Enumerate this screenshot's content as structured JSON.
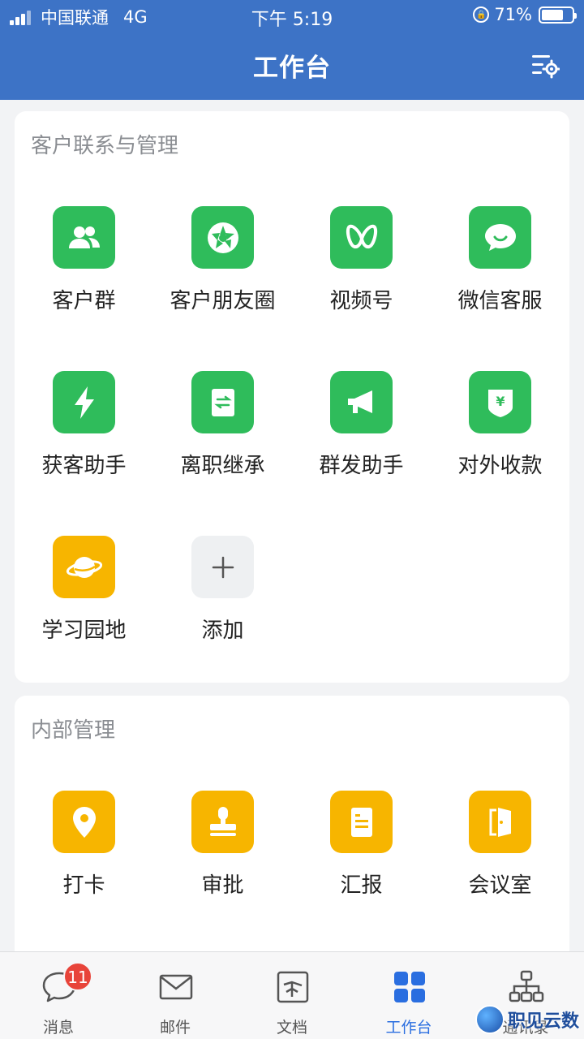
{
  "status_bar": {
    "carrier": "中国联通",
    "network": "4G",
    "time": "下午 5:19",
    "battery": "71%",
    "battery_level": 0.71
  },
  "header": {
    "title": "工作台",
    "settings_icon": "list-settings-icon",
    "background": "#3d73c6"
  },
  "sections": [
    {
      "title": "客户联系与管理",
      "items": [
        {
          "label": "客户群",
          "icon": "people-icon",
          "color": "#2fbc5b"
        },
        {
          "label": "客户朋友圈",
          "icon": "aperture-icon",
          "color": "#2fbc5b"
        },
        {
          "label": "视频号",
          "icon": "butterfly-icon",
          "color": "#2fbc5b"
        },
        {
          "label": "微信客服",
          "icon": "chat-bubble-icon",
          "color": "#2fbc5b"
        },
        {
          "label": "获客助手",
          "icon": "lightning-icon",
          "color": "#2fbc5b"
        },
        {
          "label": "离职继承",
          "icon": "transfer-doc-icon",
          "color": "#2fbc5b"
        },
        {
          "label": "群发助手",
          "icon": "megaphone-icon",
          "color": "#2fbc5b"
        },
        {
          "label": "对外收款",
          "icon": "yuan-shield-icon",
          "color": "#2fbc5b"
        },
        {
          "label": "学习园地",
          "icon": "planet-icon",
          "color": "#f7b500"
        },
        {
          "label": "添加",
          "icon": "plus-icon",
          "color": "#eef0f2"
        }
      ]
    },
    {
      "title": "内部管理",
      "items": [
        {
          "label": "打卡",
          "icon": "location-pin-icon",
          "color": "#f7b500"
        },
        {
          "label": "审批",
          "icon": "stamp-icon",
          "color": "#f7b500"
        },
        {
          "label": "汇报",
          "icon": "report-doc-icon",
          "color": "#f7b500"
        },
        {
          "label": "会议室",
          "icon": "door-icon",
          "color": "#f7b500"
        }
      ]
    }
  ],
  "tabbar": {
    "items": [
      {
        "label": "消息",
        "icon": "chat-icon",
        "badge": "11"
      },
      {
        "label": "邮件",
        "icon": "mail-icon"
      },
      {
        "label": "文档",
        "icon": "document-icon"
      },
      {
        "label": "工作台",
        "icon": "grid-icon",
        "active": true
      },
      {
        "label": "通讯录",
        "icon": "org-chart-icon"
      }
    ],
    "active_color": "#2a6ee0"
  },
  "watermark": {
    "text": "职见云数"
  }
}
